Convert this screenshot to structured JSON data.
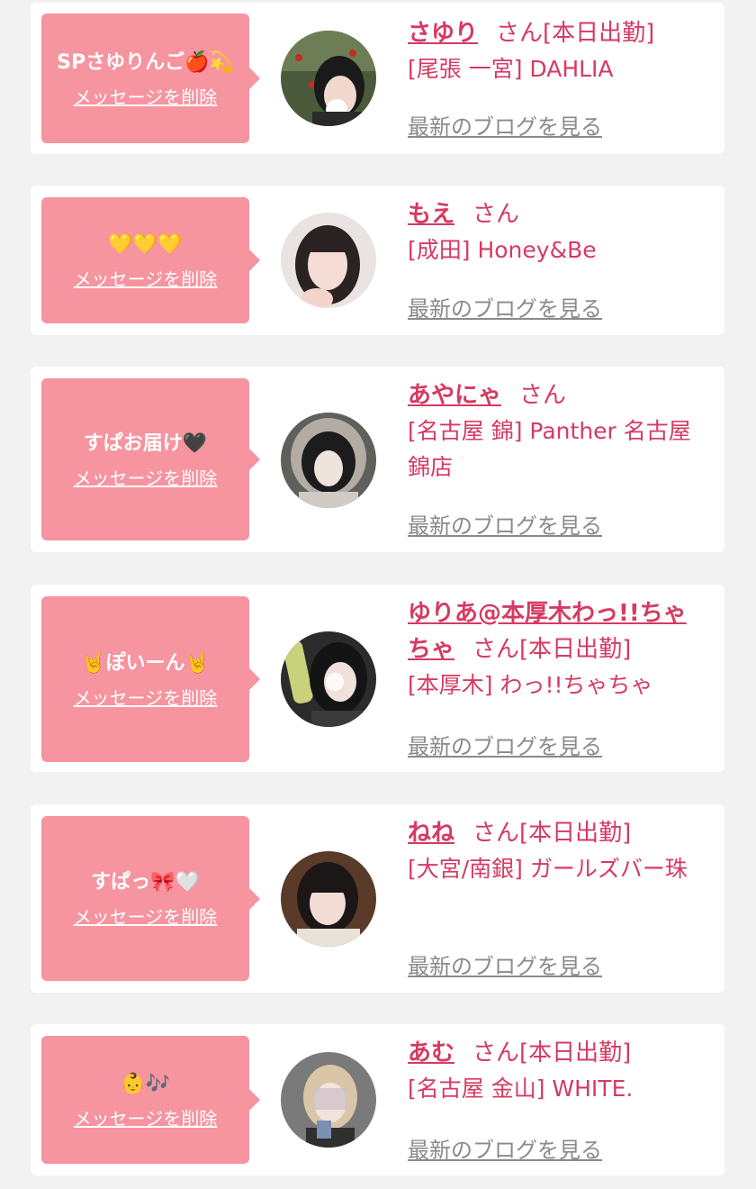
{
  "cards": [
    {
      "message": "SPさゆりんご🍎💫",
      "delete_label": "メッセージを削除",
      "name": "さゆり",
      "honorific": "さん",
      "status": "[本日出勤]",
      "shop": "[尾張 一宮] DAHLIA",
      "blog_label": "最新のブログを見る",
      "avatar": "avatar-photo"
    },
    {
      "message": "💛💛💛",
      "delete_label": "メッセージを削除",
      "name": "もえ",
      "honorific": "さん",
      "status": "",
      "shop": "[成田] Honey&Be",
      "blog_label": "最新のブログを見る",
      "avatar": "avatar-photo"
    },
    {
      "message": "すぱお届け🖤",
      "delete_label": "メッセージを削除",
      "name": "あやにゃ",
      "honorific": "さん",
      "status": "",
      "shop": "[名古屋 錦] Panther 名古屋錦店",
      "blog_label": "最新のブログを見る",
      "avatar": "avatar-photo"
    },
    {
      "message": "🤘ぽいーん🤘",
      "delete_label": "メッセージを削除",
      "name": "ゆりあ@本厚木わっ!!ちゃちゃ",
      "honorific": "さん",
      "status": "[本日出勤]",
      "shop": "[本厚木] わっ!!ちゃちゃ",
      "blog_label": "最新のブログを見る",
      "avatar": "avatar-photo"
    },
    {
      "message": "すぱっ🎀🤍",
      "delete_label": "メッセージを削除",
      "name": "ねね",
      "honorific": "さん",
      "status": "[本日出勤]",
      "shop": "[大宮/南銀] ガールズバー珠",
      "blog_label": "最新のブログを見る",
      "avatar": "avatar-photo"
    },
    {
      "message": "👶🎶",
      "delete_label": "メッセージを削除",
      "name": "あむ",
      "honorific": "さん",
      "status": "[本日出勤]",
      "shop": "[名古屋 金山] WHITE.",
      "blog_label": "最新のブログを見る",
      "avatar": "avatar-photo"
    }
  ],
  "colors": {
    "accent": "#d63a62",
    "bubble": "#f6949f",
    "link_gray": "#8a8a8a",
    "background": "#f2f2f2"
  }
}
